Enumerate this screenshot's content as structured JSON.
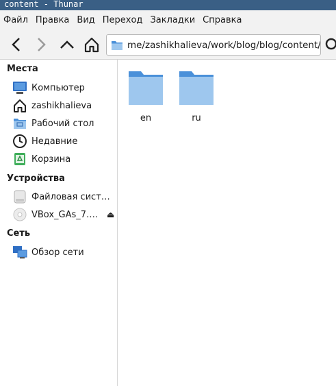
{
  "window": {
    "title": "content - Thunar"
  },
  "menu": [
    "Файл",
    "Правка",
    "Вид",
    "Переход",
    "Закладки",
    "Справка"
  ],
  "toolbar": {
    "path": "me/zashikhalieva/work/blog/blog/content/"
  },
  "sidebar": {
    "places_title": "Места",
    "places": [
      {
        "label": "Компьютер",
        "icon": "computer-icon"
      },
      {
        "label": "zashikhalieva",
        "icon": "home-icon"
      },
      {
        "label": "Рабочий стол",
        "icon": "desktop-folder-icon"
      },
      {
        "label": "Недавние",
        "icon": "recent-clock-icon"
      },
      {
        "label": "Корзина",
        "icon": "trash-icon"
      }
    ],
    "devices_title": "Устройства",
    "devices": [
      {
        "label": "Файловая сист…",
        "icon": "drive-icon"
      },
      {
        "label": "VBox_GAs_7.…",
        "icon": "optical-disc-icon"
      }
    ],
    "network_title": "Сеть",
    "network": [
      {
        "label": "Обзор сети",
        "icon": "network-icon"
      }
    ]
  },
  "files": [
    {
      "name": "en",
      "icon": "folder-icon"
    },
    {
      "name": "ru",
      "icon": "folder-icon"
    }
  ],
  "colors": {
    "titlebar": "#3a5f85",
    "folder": "#4a90d9",
    "folder_light": "#9ec7ee"
  }
}
